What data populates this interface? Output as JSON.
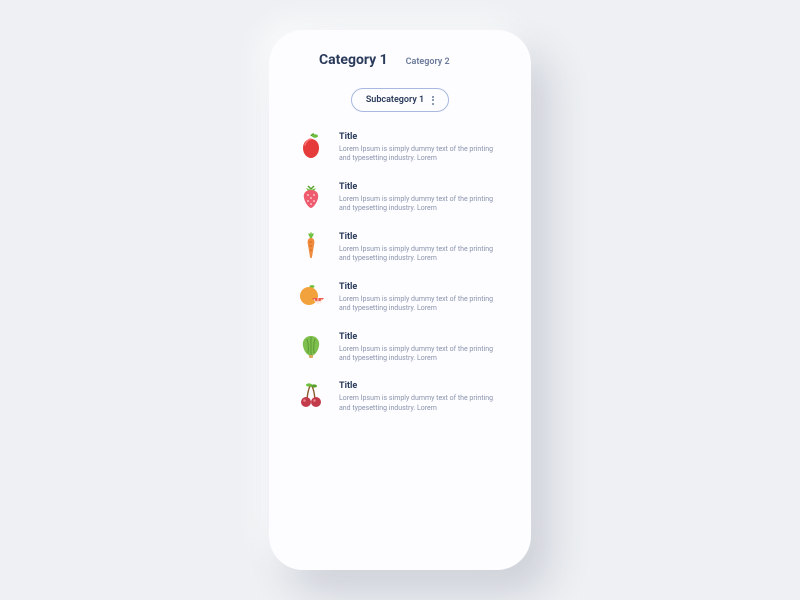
{
  "tabs": {
    "active": "Category 1",
    "inactive": "Category 2"
  },
  "subcategory": {
    "label": "Subcategory 1"
  },
  "items": [
    {
      "icon": "apple",
      "title": "Title",
      "desc": "Lorem Ipsum is simply dummy text of the printing and typesetting industry. Lorem"
    },
    {
      "icon": "strawberry",
      "title": "Title",
      "desc": "Lorem Ipsum is simply dummy text of the printing and typesetting industry. Lorem"
    },
    {
      "icon": "carrot",
      "title": "Title",
      "desc": "Lorem Ipsum is simply dummy text of the printing and typesetting industry. Lorem"
    },
    {
      "icon": "orange",
      "title": "Title",
      "desc": "Lorem Ipsum is simply dummy text of the printing and typesetting industry. Lorem"
    },
    {
      "icon": "lettuce",
      "title": "Title",
      "desc": "Lorem Ipsum is simply dummy text of the printing and typesetting industry. Lorem"
    },
    {
      "icon": "cherry",
      "title": "Title",
      "desc": "Lorem Ipsum is simply dummy text of the printing and typesetting industry. Lorem"
    }
  ]
}
